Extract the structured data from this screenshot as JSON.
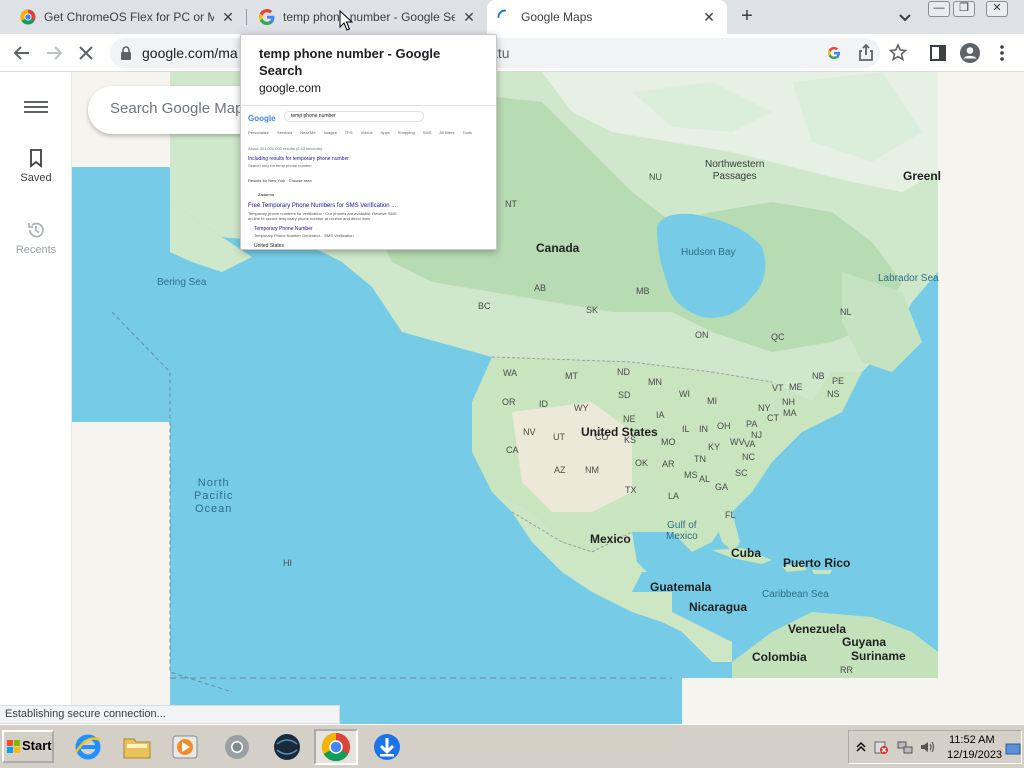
{
  "tabs": [
    {
      "title": "Get ChromeOS Flex for PC or Mac - ",
      "close": "✕"
    },
    {
      "title": "temp phone number - Google Searc",
      "close": "✕"
    },
    {
      "title": "Google Maps",
      "close": "✕"
    }
  ],
  "newtab_label": "+",
  "window_controls": {
    "minimize": "—",
    "restore": "❐",
    "close": "✕"
  },
  "address_bar": {
    "url": "google.com/ma",
    "url_tail": "ttu"
  },
  "hover_card": {
    "title": "temp phone number - Google Search",
    "domain": "google.com",
    "thumb": {
      "query": "temp phone number",
      "tabs": [
        "Personalize",
        "Services",
        "Near Me",
        "Images",
        "TPS",
        "Videos",
        "Apps",
        "Shopping",
        "SMS",
        "All filters",
        "Tools"
      ],
      "results_count": "About 301,000,000 results (0.43 seconds)",
      "including": "Including results for temporary phone number",
      "search_only": "Search only for temp phone number",
      "location": "Results for New York · Choose area",
      "result1_site": "Zadarma",
      "result1_title": "Free Temporary Phone Numbers for SMS Verification ...",
      "result1_snippet": "Temporary phone numbers for verification · Our phones are available. Receive SMS on-line to secure temporary phone number at receive and direct lines",
      "result2_title": "Temporary Phone Number",
      "result2_snippet": "Temporary Phone Number Generator... SMS Verification",
      "footer": "United States"
    }
  },
  "maps": {
    "search_placeholder": "Search Google Maps",
    "saved_label": "Saved",
    "recents_label": "Recents",
    "labels": {
      "canada": "Canada",
      "us": "United States",
      "mexico": "Mexico",
      "cuba": "Cuba",
      "puerto_rico": "Puerto Rico",
      "guatemala": "Guatemala",
      "nicaragua": "Nicaragua",
      "venezuela": "Venezuela",
      "guyana": "Guyana",
      "colombia": "Colombia",
      "suriname": "Suriname",
      "greenland": "Greenl",
      "nw_passages": "Northwestern\nPassages",
      "hudson_bay": "Hudson Bay",
      "labrador_sea": "Labrador Sea",
      "bering_sea": "Bering Sea",
      "north_pacific": "North\nPacific\nOcean",
      "gulf_mexico": "Gulf of\nMexico",
      "caribbean": "Caribbean Sea",
      "states": [
        "NU",
        "NT",
        "AB",
        "BC",
        "SK",
        "MB",
        "ON",
        "QC",
        "NL",
        "WA",
        "MT",
        "ND",
        "MN",
        "OR",
        "ID",
        "SD",
        "WI",
        "MI",
        "WY",
        "IA",
        "NE",
        "NV",
        "UT",
        "CA",
        "CO",
        "IL",
        "IN",
        "OH",
        "PA",
        "NY",
        "VT",
        "ME",
        "NB",
        "PE",
        "NS",
        "NH",
        "MA",
        "CT",
        "NJ",
        "WV",
        "KS",
        "MO",
        "KY",
        "VA",
        "AZ",
        "NM",
        "OK",
        "AR",
        "TN",
        "NC",
        "SC",
        "TX",
        "MS",
        "AL",
        "GA",
        "LA",
        "FL",
        "HI",
        "RR"
      ]
    }
  },
  "status_text": "Establishing secure connection...",
  "taskbar": {
    "start_label": "Start",
    "time": "11:52 AM",
    "date": "12/19/2023"
  },
  "colors": {
    "ocean": "#76cce6",
    "land": "#c8e6c0",
    "land_dark": "#a9d7a5",
    "arctic": "#e9f2e8",
    "chrome_blue": "#1a73e8"
  }
}
